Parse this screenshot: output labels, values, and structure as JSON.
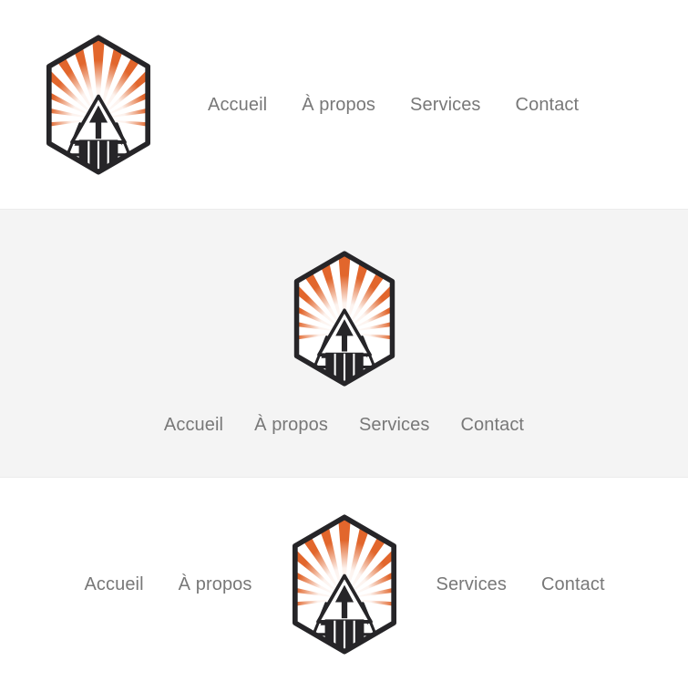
{
  "brand": {
    "logo_icon": "mountain-pencil-sunburst-hexagon-logo",
    "colors": {
      "orange": "#e2662c",
      "dark": "#262528",
      "nav_text": "#787878",
      "shade_background": "#f4f4f4",
      "light_background": "#ffffff"
    }
  },
  "headers": [
    {
      "variant": "logo-left-nav-right",
      "background": "#ffffff",
      "nav": [
        {
          "label": "Accueil"
        },
        {
          "label": "À propos"
        },
        {
          "label": "Services"
        },
        {
          "label": "Contact"
        }
      ]
    },
    {
      "variant": "logo-centered-nav-below",
      "background": "#f4f4f4",
      "nav": [
        {
          "label": "Accueil"
        },
        {
          "label": "À propos"
        },
        {
          "label": "Services"
        },
        {
          "label": "Contact"
        }
      ]
    },
    {
      "variant": "logo-centered-nav-split",
      "background": "#ffffff",
      "nav_left": [
        {
          "label": "Accueil"
        },
        {
          "label": "À propos"
        }
      ],
      "nav_right": [
        {
          "label": "Services"
        },
        {
          "label": "Contact"
        }
      ]
    }
  ]
}
